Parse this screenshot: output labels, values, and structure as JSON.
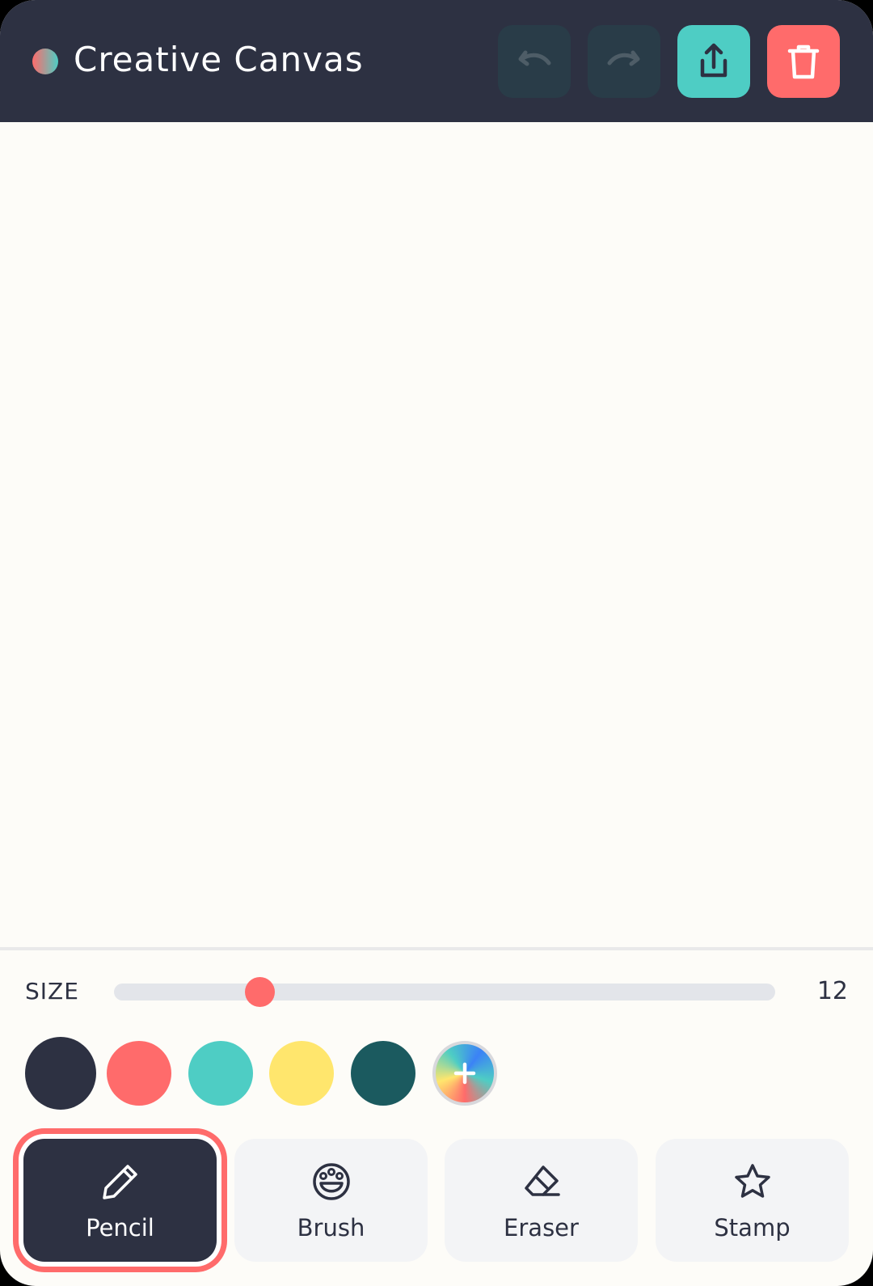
{
  "app": {
    "title": "Creative Canvas",
    "logo_icon": "gradient-dot"
  },
  "header": {
    "actions": [
      {
        "name": "undo",
        "icon": "undo-icon",
        "enabled": false
      },
      {
        "name": "redo",
        "icon": "redo-icon",
        "enabled": false
      },
      {
        "name": "share",
        "icon": "share-icon",
        "color": "#4ecdc4"
      },
      {
        "name": "delete",
        "icon": "trash-icon",
        "color": "#ff6b6b"
      }
    ]
  },
  "size": {
    "label": "SIZE",
    "value": "12",
    "slider_fraction": 0.22
  },
  "colors": {
    "swatches": [
      "#2d3142",
      "#ff6b6b",
      "#4ecdc4",
      "#ffe66d",
      "#1b5a5f"
    ],
    "selected_index": 0,
    "add_icon": "plus-icon"
  },
  "tools": [
    {
      "label": "Pencil",
      "icon": "pencil-icon",
      "active": true
    },
    {
      "label": "Brush",
      "icon": "palette-icon",
      "active": false
    },
    {
      "label": "Eraser",
      "icon": "eraser-icon",
      "active": false
    },
    {
      "label": "Stamp",
      "icon": "star-icon",
      "active": false
    }
  ],
  "theme": {
    "primary": "#2d3142",
    "accent": "#ff6b6b",
    "teal": "#4ecdc4",
    "canvas_bg": "#fdfcf8"
  }
}
